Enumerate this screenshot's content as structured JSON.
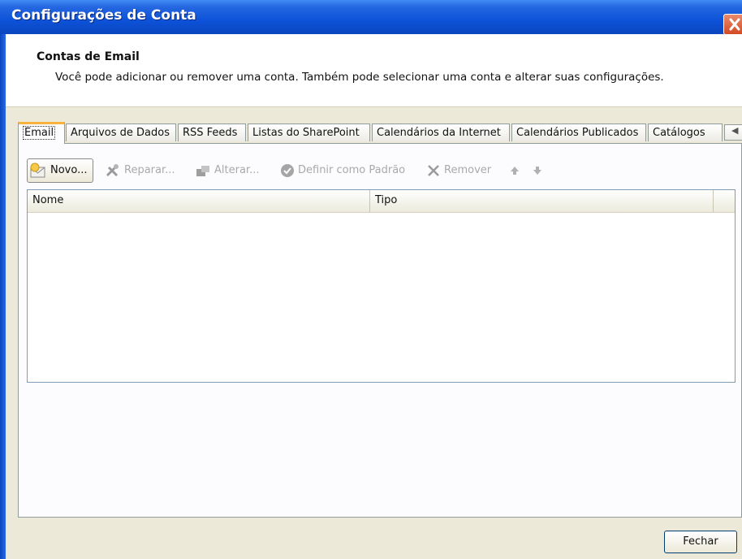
{
  "window": {
    "title": "Configurações de Conta"
  },
  "header": {
    "heading": "Contas de Email",
    "description": "Você pode adicionar ou remover uma conta. Também pode selecionar uma conta e alterar suas configurações."
  },
  "tabs": [
    {
      "label": "Email",
      "active": true
    },
    {
      "label": "Arquivos de Dados"
    },
    {
      "label": "RSS Feeds"
    },
    {
      "label": "Listas do SharePoint"
    },
    {
      "label": "Calendários da Internet"
    },
    {
      "label": "Calendários Publicados"
    },
    {
      "label": "Catálogos"
    }
  ],
  "toolbar": {
    "novo_label": "Novo...",
    "reparar_label": "Reparar...",
    "alterar_label": "Alterar...",
    "definir_label": "Definir como Padrão",
    "remover_label": "Remover"
  },
  "list": {
    "columns": [
      "Nome",
      "Tipo"
    ],
    "rows": []
  },
  "footer": {
    "close_label": "Fechar"
  },
  "colors": {
    "titlebar": "#0d52d9",
    "active_tab_accent": "#f8b33c",
    "disabled_text": "#a9a9a9"
  }
}
